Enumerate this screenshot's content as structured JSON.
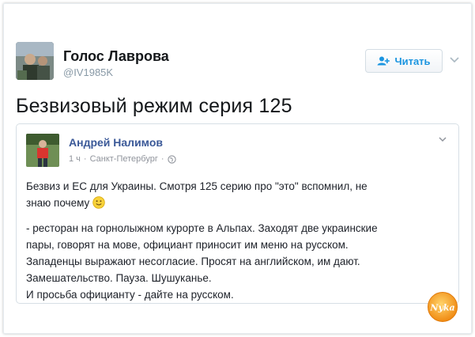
{
  "tweet": {
    "author_name": "Голос Лаврова",
    "author_handle": "@IV1985K",
    "follow_label": "Читать",
    "text": "Безвизовый режим серия 125"
  },
  "quoted_post": {
    "author_name": "Андрей Налимов",
    "time": "1 ч",
    "location": "Санкт-Петербург",
    "line1": "Безвиз и ЕС для Украины. Смотря 125 серию про \"это\" вспомнил, не",
    "line2": "знаю почему",
    "para2_line1": "- ресторан на горнолыжном курорте в Альпах. Заходят две украинские",
    "para2_line2": "пары, говорят на мове, официант приносит им меню на русском.",
    "para2_line3": "Западенцы выражают несогласие. Просят на английском, им дают.",
    "para2_line4": "Замешательство. Пауза. Шушуканье.",
    "para2_line5": "И просьба официанту - дайте на русском."
  },
  "watermark_text": "Nyka",
  "colors": {
    "follow_blue": "#1b95e0",
    "fb_name_blue": "#3b5998",
    "watermark_orange": "#f5a11e"
  },
  "icons": [
    "add-user-icon",
    "chevron-down-icon",
    "globe-icon",
    "smiley-icon"
  ]
}
